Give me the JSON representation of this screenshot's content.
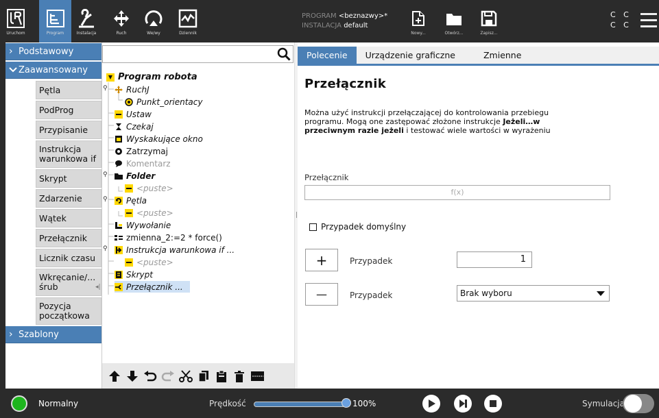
{
  "topbar": {
    "nav": [
      {
        "label": "Uruchom",
        "icon": "ur-logo-icon"
      },
      {
        "label": "Program",
        "icon": "program-icon"
      },
      {
        "label": "Instalacja",
        "icon": "installation-icon"
      },
      {
        "label": "Ruch",
        "icon": "move-icon"
      },
      {
        "label": "We/wy",
        "icon": "io-icon"
      },
      {
        "label": "Dziennik",
        "icon": "log-icon"
      }
    ],
    "program_key": "PROGRAM",
    "program_value": "<beznazwy>*",
    "install_key": "INSTALACJA",
    "install_value": "default",
    "file_buttons": [
      {
        "label": "Nowy...",
        "icon": "new-file-icon"
      },
      {
        "label": "Otwórz...",
        "icon": "folder-icon"
      },
      {
        "label": "Zapisz...",
        "icon": "save-icon"
      }
    ],
    "cc": "C C",
    "cc2": "C C"
  },
  "sidebar": {
    "basic_label": "Podstawowy",
    "advanced_label": "Zaawansowany",
    "advanced_items": [
      "Pętla",
      "PodProg",
      "Przypisanie",
      "Instrukcja warunkowa if",
      "Skrypt",
      "Zdarzenie",
      "Wątek",
      "Przełącznik",
      "Licznik czasu",
      "Wkręcanie/... śrub",
      "Pozycja początkowa"
    ],
    "templates_label": "Szablony"
  },
  "tree": {
    "search_placeholder": "",
    "nodes": [
      {
        "label": "Program robota"
      },
      {
        "label": "RuchJ"
      },
      {
        "label": "Punkt_orientacy"
      },
      {
        "label": "Ustaw"
      },
      {
        "label": "Czekaj"
      },
      {
        "label": "Wyskakujące okno"
      },
      {
        "label": "Zatrzymaj"
      },
      {
        "label": "Komentarz"
      },
      {
        "label": "Folder"
      },
      {
        "label": "<puste>"
      },
      {
        "label": "Pętla"
      },
      {
        "label": "<puste>"
      },
      {
        "label": "Wywołanie"
      },
      {
        "label": "zmienna_2:=2 * force()"
      },
      {
        "label": "Instrukcja warunkowa if ..."
      },
      {
        "label": "<puste>"
      },
      {
        "label": "Skrypt"
      },
      {
        "label": "Przełącznik ..."
      }
    ]
  },
  "tabs": [
    "Polecenie",
    "Urządzenie graficzne",
    "Zmienne"
  ],
  "command": {
    "title": "Przełącznik",
    "desc_1": "Można użyć instrukcji przełączającej do kontrolowania przebiegu programu. Mogą one zastępować złożone instrukcje ",
    "desc_b1": "Jeżeli…w przeciwnym razie jeżeli",
    "desc_2": " i testować wiele wartości w wyrażeniu",
    "switch_label": "Przełącznik",
    "expr_placeholder": "f(x)",
    "default_case_label": "Przypadek domyślny",
    "add_btn": "+",
    "remove_btn": "—",
    "case_label_1": "Przypadek",
    "case_label_2": "Przypadek",
    "case_value": "1",
    "case_select_value": "Brak wyboru"
  },
  "bottombar": {
    "status": "Normalny",
    "status_color": "#1db51d",
    "speed_label": "Prędkość",
    "speed_value": "100%",
    "speed_fraction": 1.0,
    "sim_label": "Symulacja"
  }
}
